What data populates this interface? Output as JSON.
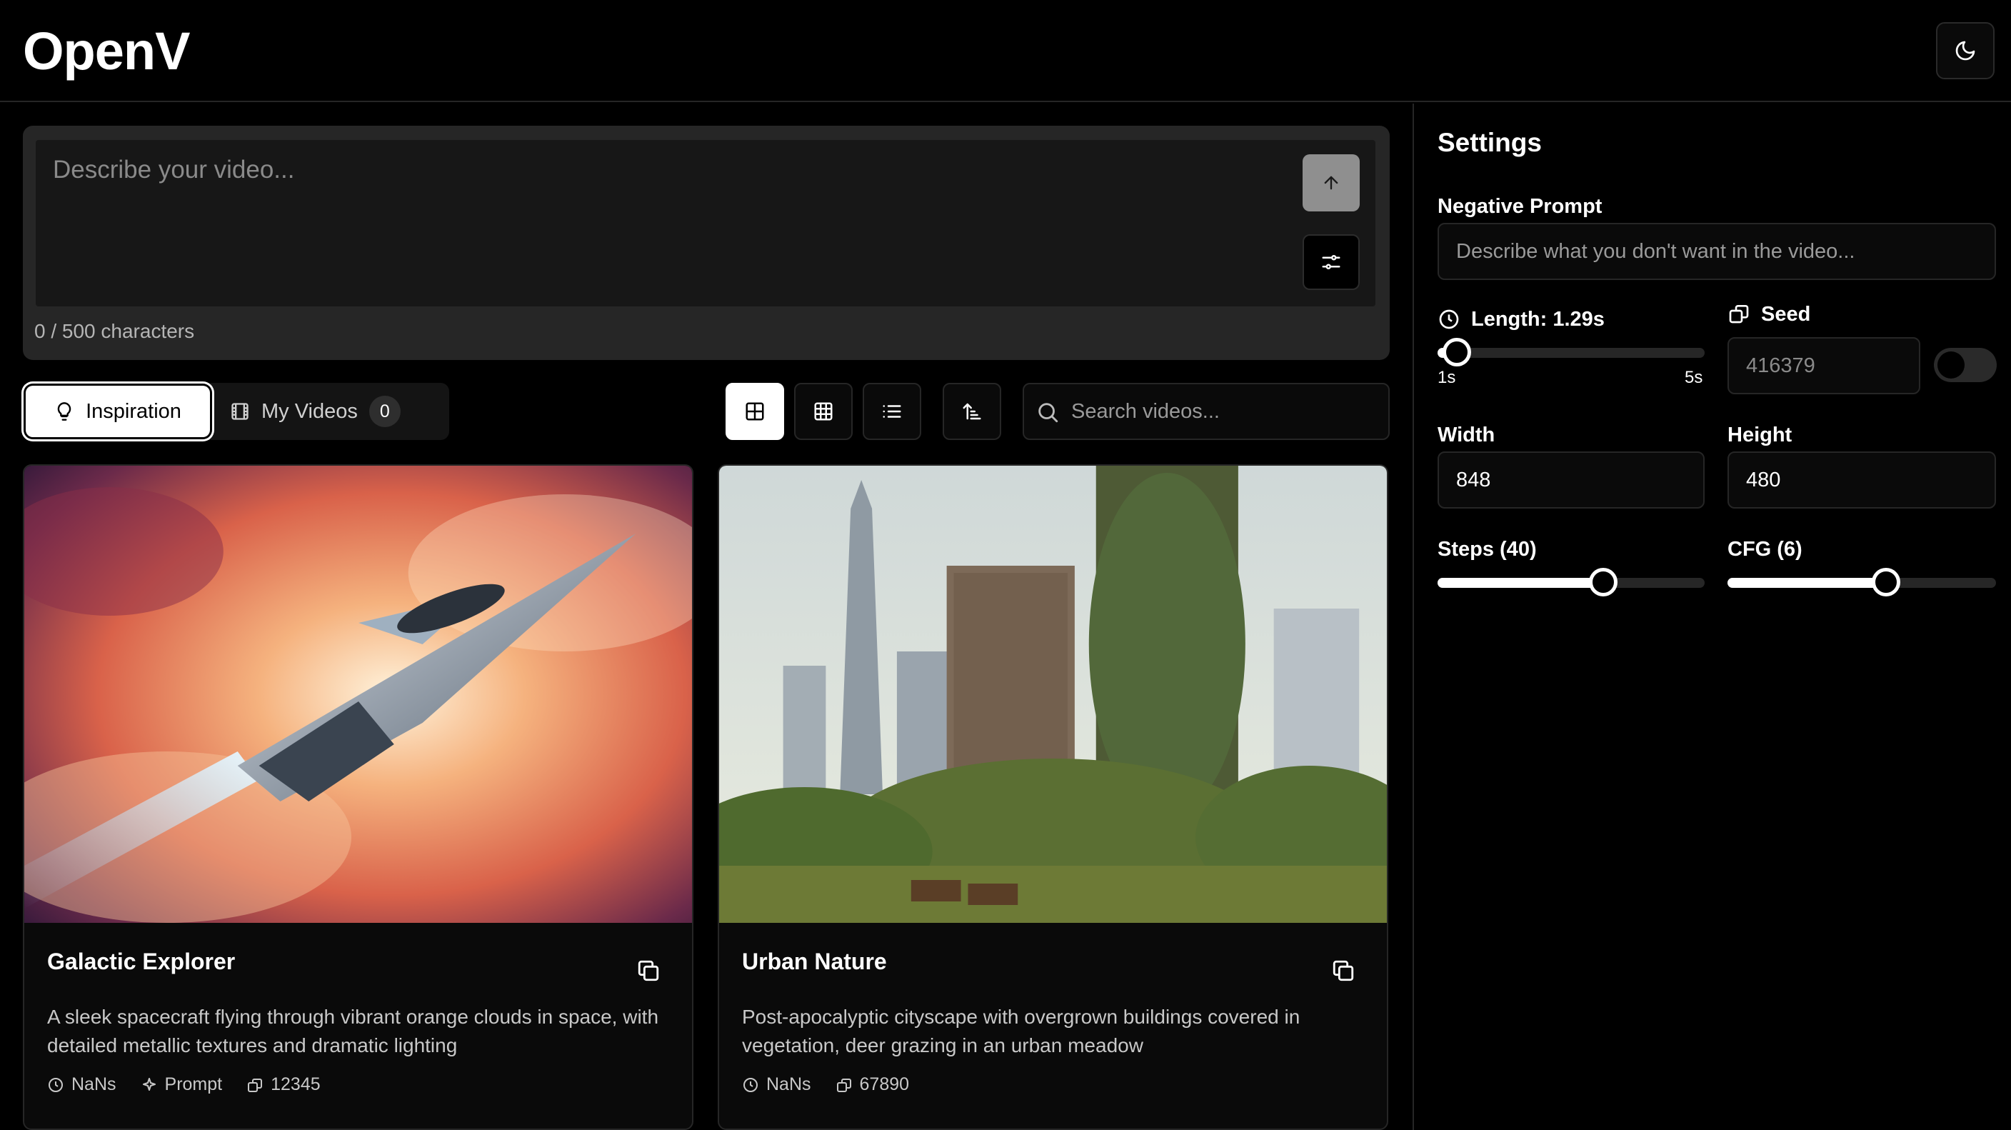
{
  "app": {
    "title": "OpenV"
  },
  "prompt": {
    "placeholder": "Describe your video...",
    "char_count": "0 / 500 characters"
  },
  "tabs": {
    "inspiration": "Inspiration",
    "my_videos": "My Videos",
    "my_videos_count": "0"
  },
  "search": {
    "placeholder": "Search videos..."
  },
  "cards": [
    {
      "title": "Galactic Explorer",
      "description": "A sleek spacecraft flying through vibrant orange clouds in space, with detailed metallic textures and dramatic lighting",
      "duration": "NaNs",
      "tag": "Prompt",
      "seed": "12345"
    },
    {
      "title": "Urban Nature",
      "description": "Post-apocalyptic cityscape with overgrown buildings covered in vegetation, deer grazing in an urban meadow",
      "duration": "NaNs",
      "seed": "67890"
    }
  ],
  "settings": {
    "title": "Settings",
    "negative_prompt_label": "Negative Prompt",
    "negative_prompt_placeholder": "Describe what you don't want in the video...",
    "length_label": "Length: 1.29s",
    "length_value": 1.29,
    "length_min": "1s",
    "length_max": "5s",
    "seed_label": "Seed",
    "seed_value": "416379",
    "seed_random": false,
    "width_label": "Width",
    "width_value": "848",
    "height_label": "Height",
    "height_value": "480",
    "steps_label": "Steps (40)",
    "steps_fraction": 0.62,
    "cfg_label": "CFG (6)",
    "cfg_fraction": 0.59
  },
  "colors": {
    "background": "#000000",
    "panel": "#262626",
    "accent": "#ffffff"
  },
  "icons": [
    "moon-icon",
    "arrow-up-icon",
    "sliders-icon",
    "lightbulb-icon",
    "film-icon",
    "grid-large-icon",
    "grid-small-icon",
    "list-icon",
    "sort-icon",
    "search-icon",
    "copy-icon",
    "clock-icon",
    "sparkle-icon",
    "dice-icon"
  ]
}
